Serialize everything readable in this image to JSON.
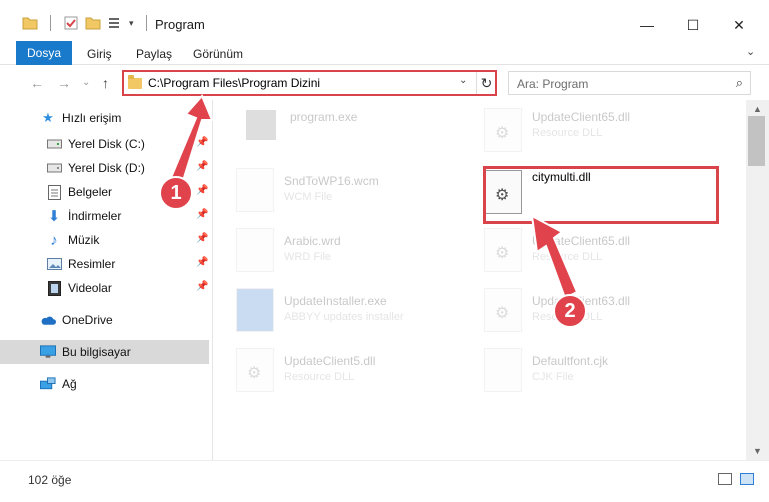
{
  "window": {
    "title": "Program",
    "controls": [
      "—",
      "☐",
      "✕"
    ]
  },
  "ribbon": {
    "tabs": [
      "Dosya",
      "Giriş",
      "Paylaş",
      "Görünüm"
    ]
  },
  "address": {
    "path": "C:\\Program Files\\Program Dizini",
    "search_placeholder": "Ara: Program"
  },
  "nav": {
    "items": [
      {
        "label": "Hızlı erişim",
        "icon": "star-icon",
        "pinned": false
      },
      {
        "label": "Yerel Disk (C:)",
        "icon": "drive-icon",
        "pinned": true
      },
      {
        "label": "Yerel Disk (D:)",
        "icon": "drive-icon",
        "pinned": true
      },
      {
        "label": "Belgeler",
        "icon": "documents-icon",
        "pinned": true
      },
      {
        "label": "İndirmeler",
        "icon": "download-icon",
        "pinned": true
      },
      {
        "label": "Müzik",
        "icon": "music-icon",
        "pinned": true
      },
      {
        "label": "Resimler",
        "icon": "pictures-icon",
        "pinned": true
      },
      {
        "label": "Videolar",
        "icon": "videos-icon",
        "pinned": true
      },
      {
        "label": "OneDrive",
        "icon": "cloud-icon",
        "pinned": false
      },
      {
        "label": "Bu bilgisayar",
        "icon": "computer-icon",
        "pinned": false,
        "selected": true
      },
      {
        "label": "Ağ",
        "icon": "network-icon",
        "pinned": false
      }
    ]
  },
  "files": {
    "left": [
      {
        "name": "program.exe",
        "type": ""
      },
      {
        "name": "SndToWP16.wcm",
        "type": "WCM File"
      },
      {
        "name": "Arabic.wrd",
        "type": "WRD File"
      },
      {
        "name": "UpdateInstaller.exe",
        "type": "ABBYY updates installer"
      },
      {
        "name": "UpdateClient5.dll",
        "type": "Resource DLL"
      }
    ],
    "right": [
      {
        "name": "UpdateClient65.dll",
        "type": "Resource DLL"
      },
      {
        "name": "citymulti.dll",
        "type": ""
      },
      {
        "name": "UpdateClient65.dll",
        "type": "Resource DLL"
      },
      {
        "name": "UpdateClient63.dll",
        "type": "Resource DLL"
      },
      {
        "name": "Defaultfont.cjk",
        "type": "CJK File"
      }
    ]
  },
  "callouts": [
    "1",
    "2"
  ],
  "status": {
    "count": "102 öğe"
  },
  "colors": {
    "accent": "#1979ca",
    "highlight": "#d9444b"
  }
}
